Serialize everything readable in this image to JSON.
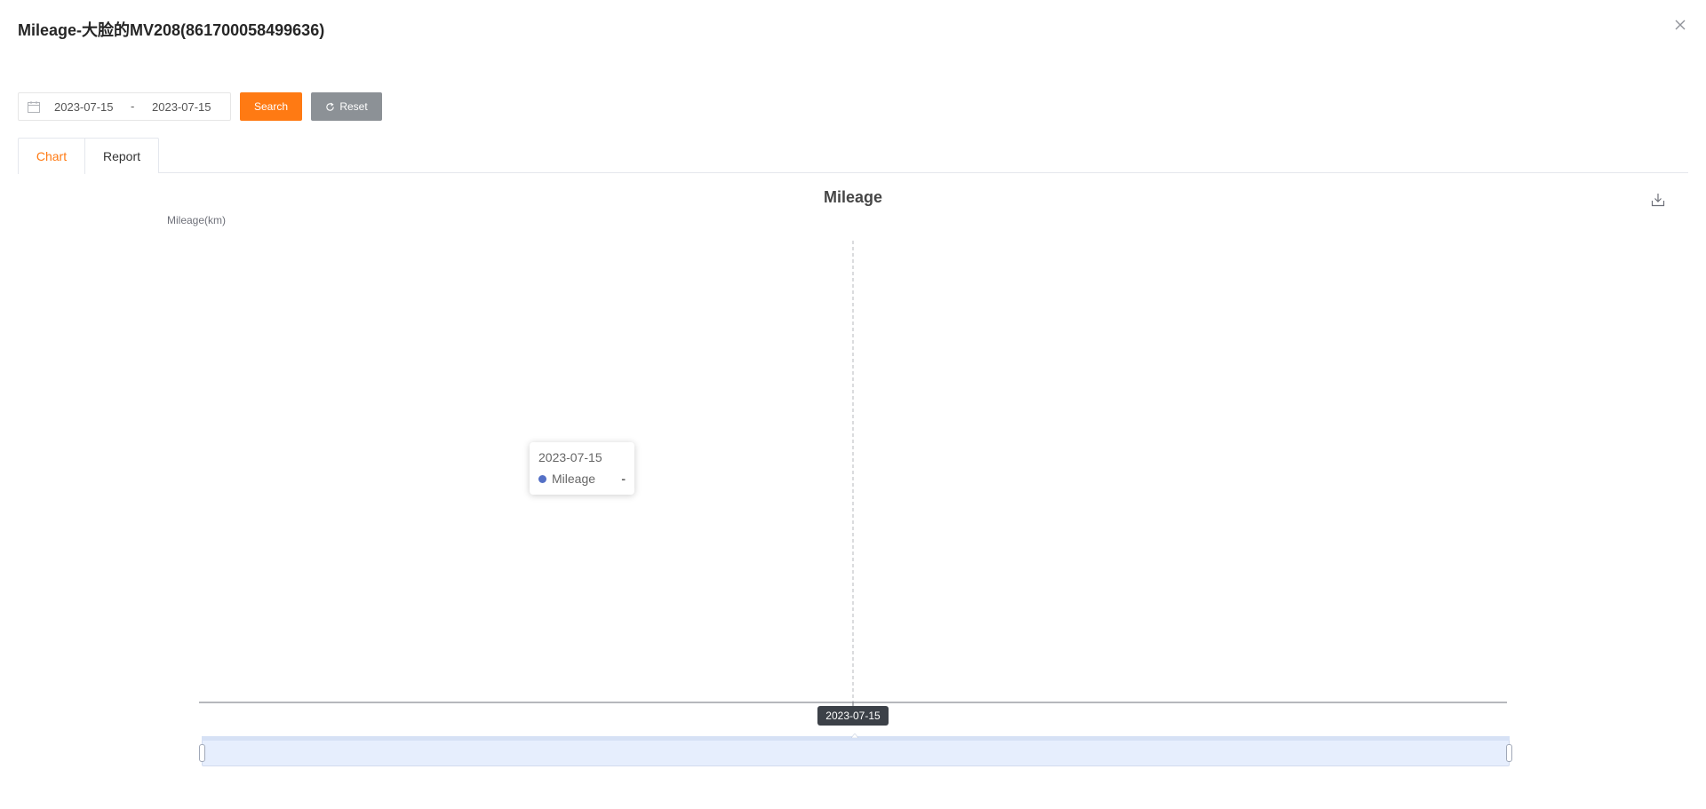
{
  "dialog": {
    "title": "Mileage-大脸的MV208(861700058499636)"
  },
  "filters": {
    "start_date": "2023-07-15",
    "separator": "-",
    "end_date": "2023-07-15",
    "search_label": "Search",
    "reset_label": "Reset"
  },
  "tabs": [
    {
      "label": "Chart",
      "active": true
    },
    {
      "label": "Report",
      "active": false
    }
  ],
  "tooltip": {
    "date": "2023-07-15",
    "series_name": "Mileage",
    "value": "-",
    "marker_color": "#5470c6"
  },
  "axis_pointer_label": "2023-07-15",
  "colors": {
    "accent": "#ff7a13",
    "reset_button": "#8c9196",
    "series": "#5470c6",
    "datazoom_fill": "#e6eefd"
  },
  "icons": [
    "close-icon",
    "calendar-icon",
    "refresh-icon",
    "download-icon"
  ],
  "chart_data": {
    "type": "line",
    "title": "Mileage",
    "ylabel": "Mileage(km)",
    "xlabel": "",
    "categories": [
      "2023-07-15"
    ],
    "series": [
      {
        "name": "Mileage",
        "values": [
          null
        ]
      }
    ],
    "grid": false,
    "datazoom": {
      "start_percent": 0,
      "end_percent": 100
    }
  }
}
